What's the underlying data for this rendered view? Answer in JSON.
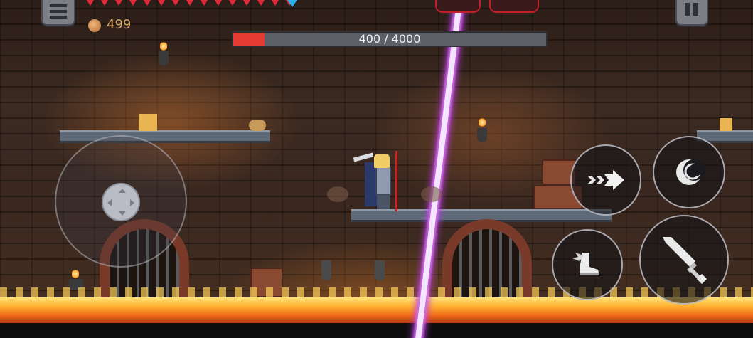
{
  "hud": {
    "hearts_count": 15,
    "coins": "499",
    "menu_icon": "menu-icon",
    "pause_icon": "pause-icon"
  },
  "boss": {
    "health_text": "400 / 4000",
    "health_current": 400,
    "health_max": 4000,
    "bar_color": "#e33b2f"
  },
  "controls": {
    "joystick": "virtual-joystick",
    "dash_icon": "dash-arrow-icon",
    "skill_icon": "crescent-moon-icon",
    "jump_icon": "winged-boot-icon",
    "attack_icon": "sword-icon"
  },
  "colors": {
    "laser": "#c03ae8",
    "lava": "#f06a18",
    "heart": "#e02a3a",
    "shield": "#2ab4ee",
    "coin_text": "#d9a868"
  }
}
